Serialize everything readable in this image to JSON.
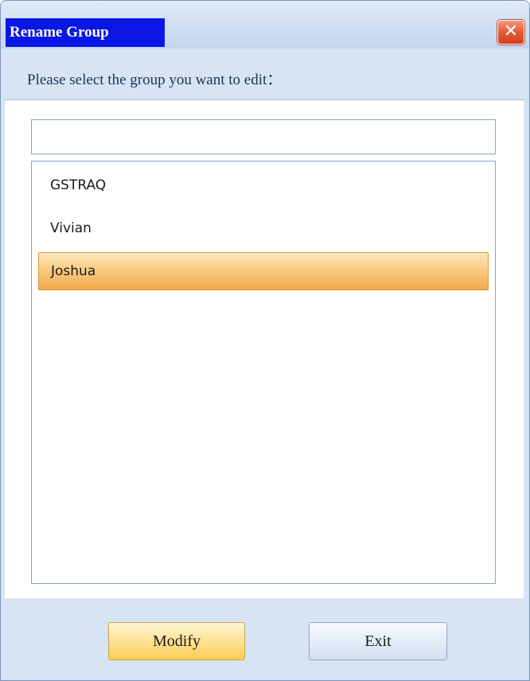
{
  "window": {
    "title": "Rename Group",
    "close_glyph": "✕"
  },
  "prompt": {
    "text": "Please select the group you want to edit："
  },
  "search": {
    "value": ""
  },
  "groups": {
    "items": [
      {
        "label": "GSTRAQ",
        "selected": false
      },
      {
        "label": "Vivian",
        "selected": false
      },
      {
        "label": "Joshua",
        "selected": true
      }
    ]
  },
  "buttons": {
    "modify_label": "Modify",
    "exit_label": "Exit"
  },
  "colors": {
    "title_block": "#0a16e6",
    "selection": "#f9cd84",
    "close_button": "#e35a37"
  }
}
